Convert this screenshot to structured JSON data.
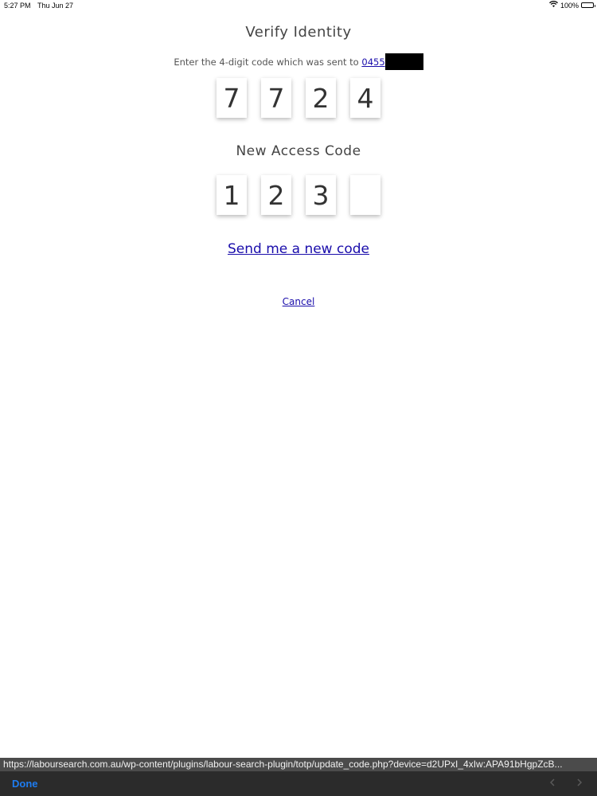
{
  "status_bar": {
    "time": "5:27 PM",
    "date": "Thu Jun 27",
    "battery": "100%",
    "battery_level": 1.0
  },
  "page": {
    "title": "Verify Identity",
    "instruction_prefix": "Enter the 4-digit code which was sent to",
    "phone_visible": "0455",
    "verify_code_digits": [
      "7",
      "7",
      "2",
      "4"
    ],
    "new_access_code_label": "New Access Code",
    "new_code_digits": [
      "1",
      "2",
      "3",
      ""
    ],
    "send_new_code_link": "Send me a new code",
    "cancel_link": "Cancel"
  },
  "browser": {
    "url": "https://laboursearch.com.au/wp-content/plugins/labour-search-plugin/totp/update_code.php?device=d2UPxI_4xIw:APA91bHgpZcB...",
    "done_label": "Done",
    "back_icon": "chevron-left-icon",
    "forward_icon": "chevron-right-icon"
  },
  "colors": {
    "link": "#1a0dab",
    "done": "#1e7cf0",
    "url_bar_bg": "#4b4b4b",
    "toolbar_bg": "#2b2b2b"
  }
}
